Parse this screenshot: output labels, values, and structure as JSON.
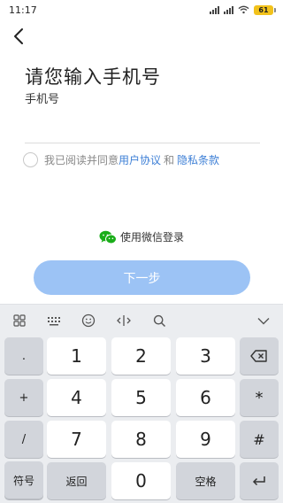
{
  "status_bar": {
    "time": "11:17",
    "battery": "61"
  },
  "page": {
    "title": "请您输入手机号",
    "subtitle": "手机号",
    "phone_value": "",
    "agreement": {
      "prefix": "我已阅读并同意",
      "user_agreement": "用户协议",
      "conjunction": "和",
      "privacy_policy": "隐私条款"
    },
    "wechat_login": "使用微信登录",
    "next_button": "下一步"
  },
  "keyboard": {
    "toolbar_icons": [
      "grid-icon",
      "keyboard-icon",
      "emoji-icon",
      "cursor-move-icon",
      "search-icon",
      "chevron-down-icon"
    ],
    "side_keys": [
      ".",
      "+",
      "/",
      "-"
    ],
    "digits": [
      "1",
      "2",
      "3",
      "4",
      "5",
      "6",
      "7",
      "8",
      "9",
      "0"
    ],
    "right_keys": {
      "backspace": "⌫",
      "star": "*",
      "hash": "#",
      "enter": "↵"
    },
    "bottom": {
      "symbols": "符号",
      "back": "返回",
      "space": "空格"
    }
  },
  "colors": {
    "accent": "#3d7fd6",
    "button": "#9cc3f5",
    "wechat": "#1aad19",
    "battery": "#f2c21b"
  }
}
